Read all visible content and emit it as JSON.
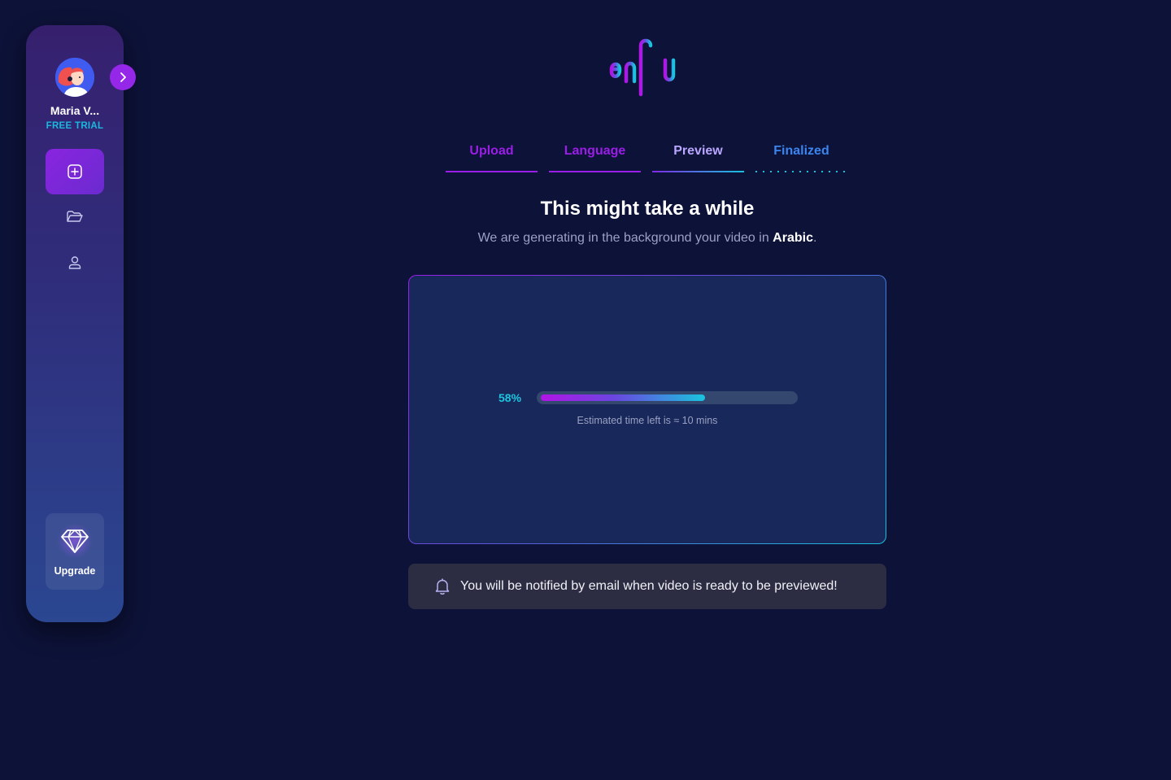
{
  "user": {
    "name": "Maria V...",
    "plan": "FREE TRIAL"
  },
  "sidebar": {
    "items": [
      {
        "icon": "plus-square-icon",
        "active": true
      },
      {
        "icon": "folder-open-icon",
        "active": false
      },
      {
        "icon": "user-icon",
        "active": false
      }
    ],
    "upgrade_label": "Upgrade",
    "upgrade_icon": "diamond-icon",
    "expand_icon": "chevron-right-icon"
  },
  "brand": {
    "logo_text": "enflu"
  },
  "steps": [
    {
      "label": "Upload",
      "state": "done"
    },
    {
      "label": "Language",
      "state": "done"
    },
    {
      "label": "Preview",
      "state": "current"
    },
    {
      "label": "Finalized",
      "state": "pending"
    }
  ],
  "main": {
    "title": "This might take a while",
    "subtitle_prefix": "We are generating in the background your video in ",
    "subtitle_language": "Arabic",
    "subtitle_suffix": "."
  },
  "progress": {
    "percent_label": "58%",
    "fraction": 0.58,
    "eta_text": "Estimated time left is ≈ 10 mins"
  },
  "notice": {
    "icon": "bell-icon",
    "text": "You will be notified by email when video is ready to be previewed!"
  },
  "colors": {
    "background": "#0d1238",
    "accent_purple": "#9a1ee6",
    "accent_cyan": "#19c2dc",
    "accent_blue": "#3c84ee"
  }
}
